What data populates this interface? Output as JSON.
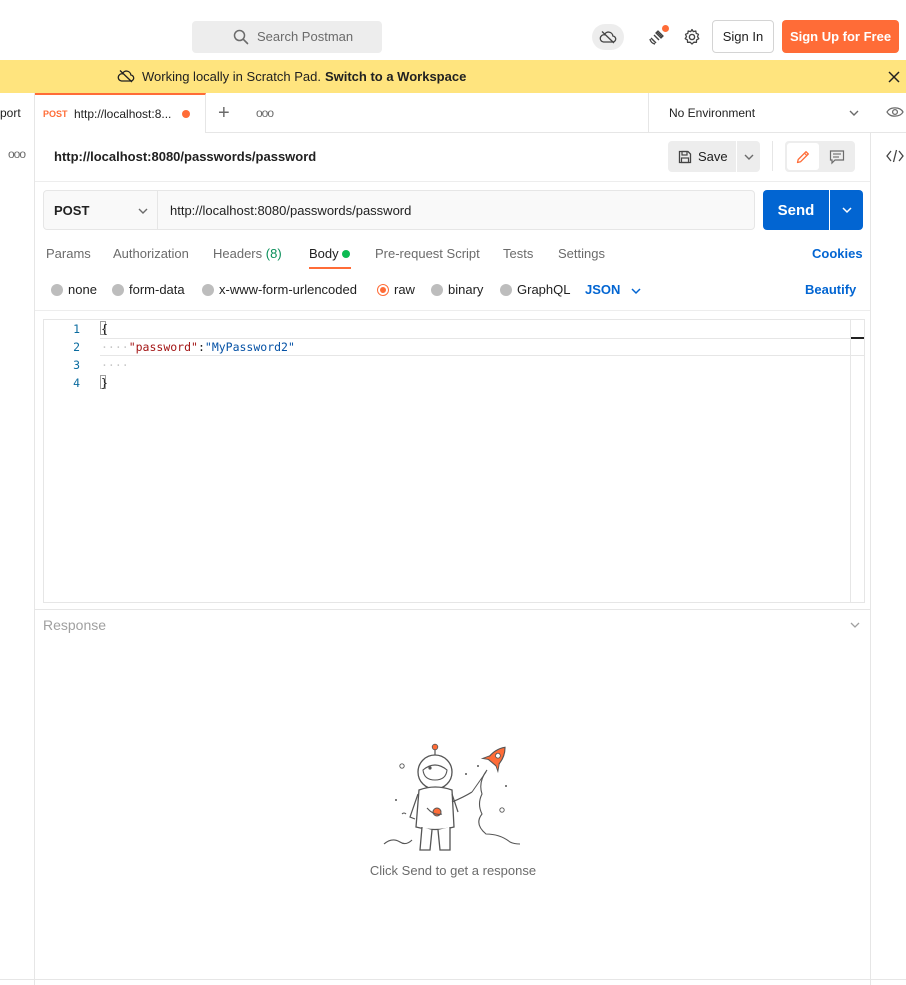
{
  "header": {
    "search_placeholder": "Search Postman",
    "sign_in_label": "Sign In",
    "sign_up_label": "Sign Up for Free"
  },
  "banner": {
    "text": "Working locally in Scratch Pad.",
    "link": "Switch to a Workspace"
  },
  "sidebar": {
    "tab_fragment": "port"
  },
  "tabs": {
    "active": {
      "method": "POST",
      "title": "http://localhost:8..."
    }
  },
  "environment": {
    "selected": "No Environment"
  },
  "request": {
    "title": "http://localhost:8080/passwords/password",
    "save_label": "Save",
    "method": "POST",
    "url": "http://localhost:8080/passwords/password",
    "send_label": "Send",
    "tabs": {
      "params": "Params",
      "authorization": "Authorization",
      "headers": "Headers",
      "headers_count": "(8)",
      "body": "Body",
      "prerequest": "Pre-request Script",
      "tests": "Tests",
      "settings": "Settings"
    },
    "cookies_label": "Cookies",
    "body_types": {
      "none": "none",
      "form_data": "form-data",
      "urlencoded": "x-www-form-urlencoded",
      "raw": "raw",
      "binary": "binary",
      "graphql": "GraphQL"
    },
    "selected_body_type": "raw",
    "format": "JSON",
    "beautify_label": "Beautify",
    "editor": {
      "line_numbers": [
        "1",
        "2",
        "3",
        "4"
      ],
      "line1": "{",
      "line2_key": "\"password\"",
      "line2_colon": ":",
      "line2_value": "\"MyPassword2\"",
      "line4": "}"
    }
  },
  "response": {
    "title": "Response",
    "hint": "Click Send to get a response"
  },
  "colors": {
    "accent": "#ff6c37",
    "primary": "#0265d2",
    "banner": "#ffe47e",
    "success": "#0cbb52"
  }
}
